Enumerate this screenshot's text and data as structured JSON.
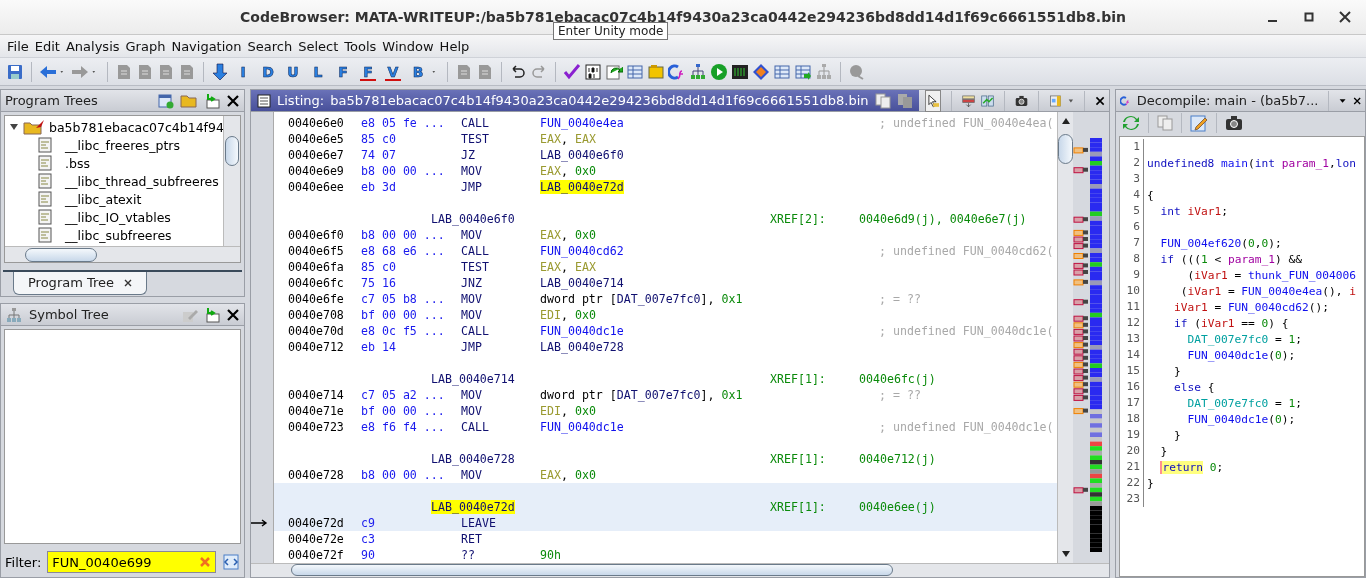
{
  "window": {
    "title": "CodeBrowser: MATA-WRITEUP:/ba5b781ebacac07c4b14f9430a23ca0442e294236bd8dd14d1f69c6661551db8.bin",
    "tooltip": "Enter Unity mode"
  },
  "menu": [
    "File",
    "Edit",
    "Analysis",
    "Graph",
    "Navigation",
    "Search",
    "Select",
    "Tools",
    "Window",
    "Help"
  ],
  "toolbar": {
    "letter_buttons": [
      {
        "glyph": "I",
        "crossed": false
      },
      {
        "glyph": "D",
        "crossed": false
      },
      {
        "glyph": "U",
        "crossed": false
      },
      {
        "glyph": "L",
        "crossed": false
      },
      {
        "glyph": "F",
        "crossed": false
      },
      {
        "glyph": "F",
        "crossed": true
      },
      {
        "glyph": "V",
        "crossed": true
      },
      {
        "glyph": "B",
        "crossed": false
      }
    ]
  },
  "program_trees": {
    "title": "Program Trees",
    "root": {
      "label": "ba5b781ebacac07c4b14f94",
      "expanded": true,
      "children": [
        {
          "label": "__libc_freeres_ptrs"
        },
        {
          "label": ".bss"
        },
        {
          "label": "__libc_thread_subfreeres"
        },
        {
          "label": "__libc_atexit"
        },
        {
          "label": "__libc_IO_vtables"
        },
        {
          "label": "__libc_subfreeres"
        }
      ]
    },
    "tabs": [
      {
        "label": "Program Tree",
        "selected": true
      }
    ]
  },
  "symbol_tree": {
    "title": "Symbol Tree",
    "filter_label": "Filter:",
    "filter": {
      "value": "FUN_0040e699"
    }
  },
  "listing": {
    "title": "Listing:",
    "file": "ba5b781ebacac07c4b14f9430a23ca0442e294236bd8dd14d1f69c6661551db8.bin",
    "rows": [
      {
        "kind": "instr",
        "address": "0040e6e0",
        "bytes": "e8 05 fe ...",
        "mnemonic": "CALL",
        "operands": [
          {
            "text": "FUN_0040e4ea",
            "kind": "fn"
          }
        ],
        "comment": "; undefined FUN_0040e4ea(",
        "selected": false,
        "current": false
      },
      {
        "kind": "instr",
        "address": "0040e6e5",
        "bytes": "85 c0",
        "mnemonic": "TEST",
        "operands": [
          {
            "text": "EAX",
            "kind": "reg"
          },
          {
            "text": ", ",
            "kind": "plain"
          },
          {
            "text": "EAX",
            "kind": "reg"
          }
        ],
        "selected": false,
        "current": false
      },
      {
        "kind": "instr",
        "address": "0040e6e7",
        "bytes": "74 07",
        "mnemonic": "JZ",
        "operands": [
          {
            "text": "LAB_0040e6f0",
            "kind": "lab"
          }
        ],
        "selected": false,
        "current": false
      },
      {
        "kind": "instr",
        "address": "0040e6e9",
        "bytes": "b8 00 00 ...",
        "mnemonic": "MOV",
        "operands": [
          {
            "text": "EAX",
            "kind": "reg"
          },
          {
            "text": ", ",
            "kind": "plain"
          },
          {
            "text": "0x0",
            "kind": "num"
          }
        ],
        "selected": false,
        "current": false
      },
      {
        "kind": "instr",
        "address": "0040e6ee",
        "bytes": "eb 3d",
        "mnemonic": "JMP",
        "operands": [
          {
            "text": "LAB_0040e72d",
            "kind": "lab",
            "highlighted": true
          }
        ],
        "selected": false,
        "current": false
      },
      {
        "kind": "blank",
        "selected": false
      },
      {
        "kind": "label",
        "label": "LAB_0040e6f0",
        "label_highlighted": false,
        "xref_label": "XREF[2]:",
        "xref_targets": "0040e6d9(j), 0040e6e7(j)",
        "selected": false
      },
      {
        "kind": "instr",
        "address": "0040e6f0",
        "bytes": "b8 00 00 ...",
        "mnemonic": "MOV",
        "operands": [
          {
            "text": "EAX",
            "kind": "reg"
          },
          {
            "text": ", ",
            "kind": "plain"
          },
          {
            "text": "0x0",
            "kind": "num"
          }
        ],
        "selected": false,
        "current": false
      },
      {
        "kind": "instr",
        "address": "0040e6f5",
        "bytes": "e8 68 e6 ...",
        "mnemonic": "CALL",
        "operands": [
          {
            "text": "FUN_0040cd62",
            "kind": "fn"
          }
        ],
        "comment": "; undefined FUN_0040cd62(",
        "selected": false,
        "current": false
      },
      {
        "kind": "instr",
        "address": "0040e6fa",
        "bytes": "85 c0",
        "mnemonic": "TEST",
        "operands": [
          {
            "text": "EAX",
            "kind": "reg"
          },
          {
            "text": ", ",
            "kind": "plain"
          },
          {
            "text": "EAX",
            "kind": "reg"
          }
        ],
        "selected": false,
        "current": false
      },
      {
        "kind": "instr",
        "address": "0040e6fc",
        "bytes": "75 16",
        "mnemonic": "JNZ",
        "operands": [
          {
            "text": "LAB_0040e714",
            "kind": "lab"
          }
        ],
        "selected": false,
        "current": false
      },
      {
        "kind": "instr",
        "address": "0040e6fe",
        "bytes": "c7 05 b8 ...",
        "mnemonic": "MOV",
        "operands": [
          {
            "text": "dword ptr [",
            "kind": "plain"
          },
          {
            "text": "DAT_007e7fc0",
            "kind": "lab"
          },
          {
            "text": "], ",
            "kind": "plain"
          },
          {
            "text": "0x1",
            "kind": "num"
          }
        ],
        "comment": "; = ??",
        "selected": false,
        "current": false
      },
      {
        "kind": "instr",
        "address": "0040e708",
        "bytes": "bf 00 00 ...",
        "mnemonic": "MOV",
        "operands": [
          {
            "text": "EDI",
            "kind": "reg"
          },
          {
            "text": ", ",
            "kind": "plain"
          },
          {
            "text": "0x0",
            "kind": "num"
          }
        ],
        "selected": false,
        "current": false
      },
      {
        "kind": "instr",
        "address": "0040e70d",
        "bytes": "e8 0c f5 ...",
        "mnemonic": "CALL",
        "operands": [
          {
            "text": "FUN_0040dc1e",
            "kind": "fn"
          }
        ],
        "comment": "; undefined FUN_0040dc1e(",
        "selected": false,
        "current": false
      },
      {
        "kind": "instr",
        "address": "0040e712",
        "bytes": "eb 14",
        "mnemonic": "JMP",
        "operands": [
          {
            "text": "LAB_0040e728",
            "kind": "lab"
          }
        ],
        "selected": false,
        "current": false
      },
      {
        "kind": "blank",
        "selected": false
      },
      {
        "kind": "label",
        "label": "LAB_0040e714",
        "label_highlighted": false,
        "xref_label": "XREF[1]:",
        "xref_targets": "0040e6fc(j)",
        "selected": false
      },
      {
        "kind": "instr",
        "address": "0040e714",
        "bytes": "c7 05 a2 ...",
        "mnemonic": "MOV",
        "operands": [
          {
            "text": "dword ptr [",
            "kind": "plain"
          },
          {
            "text": "DAT_007e7fc0",
            "kind": "lab"
          },
          {
            "text": "], ",
            "kind": "plain"
          },
          {
            "text": "0x1",
            "kind": "num"
          }
        ],
        "comment": "; = ??",
        "selected": false,
        "current": false
      },
      {
        "kind": "instr",
        "address": "0040e71e",
        "bytes": "bf 00 00 ...",
        "mnemonic": "MOV",
        "operands": [
          {
            "text": "EDI",
            "kind": "reg"
          },
          {
            "text": ", ",
            "kind": "plain"
          },
          {
            "text": "0x0",
            "kind": "num"
          }
        ],
        "selected": false,
        "current": false
      },
      {
        "kind": "instr",
        "address": "0040e723",
        "bytes": "e8 f6 f4 ...",
        "mnemonic": "CALL",
        "operands": [
          {
            "text": "FUN_0040dc1e",
            "kind": "fn"
          }
        ],
        "comment": "; undefined FUN_0040dc1e(",
        "selected": false,
        "current": false
      },
      {
        "kind": "blank",
        "selected": false
      },
      {
        "kind": "label",
        "label": "LAB_0040e728",
        "label_highlighted": false,
        "xref_label": "XREF[1]:",
        "xref_targets": "0040e712(j)",
        "selected": false
      },
      {
        "kind": "instr",
        "address": "0040e728",
        "bytes": "b8 00 00 ...",
        "mnemonic": "MOV",
        "operands": [
          {
            "text": "EAX",
            "kind": "reg"
          },
          {
            "text": ", ",
            "kind": "plain"
          },
          {
            "text": "0x0",
            "kind": "num"
          }
        ],
        "selected": false,
        "current": false
      },
      {
        "kind": "blank",
        "selected": true
      },
      {
        "kind": "label",
        "label": "LAB_0040e72d",
        "label_highlighted": true,
        "xref_label": "XREF[1]:",
        "xref_targets": "0040e6ee(j)",
        "selected": true
      },
      {
        "kind": "instr",
        "address": "0040e72d",
        "bytes": "c9",
        "mnemonic": "LEAVE",
        "operands": [],
        "selected": true,
        "current": true
      },
      {
        "kind": "instr",
        "address": "0040e72e",
        "bytes": "c3",
        "mnemonic": "RET",
        "operands": [],
        "selected": false,
        "current": false
      },
      {
        "kind": "instr",
        "address": "0040e72f",
        "bytes": "90",
        "mnemonic": "??",
        "operands": [
          {
            "text": "90h",
            "kind": "num"
          }
        ],
        "selected": false,
        "current": false
      }
    ]
  },
  "decompile": {
    "title": "Decompile: main -  (ba5b7...",
    "lines": [
      {
        "number": "1"
      },
      {
        "number": "2",
        "tokens": [
          {
            "text": "undefined8 ",
            "kind": "kw"
          },
          {
            "text": "main",
            "kind": "fn"
          },
          {
            "text": "(",
            "kind": "plain"
          },
          {
            "text": "int ",
            "kind": "kw"
          },
          {
            "text": "param_1",
            "kind": "param"
          },
          {
            "text": ",",
            "kind": "plain"
          },
          {
            "text": "lon",
            "kind": "kw"
          }
        ]
      },
      {
        "number": "3"
      },
      {
        "number": "4",
        "tokens": [
          {
            "text": "{",
            "kind": "plain"
          }
        ]
      },
      {
        "number": "5",
        "tokens": [
          {
            "text": "  int ",
            "kind": "kw"
          },
          {
            "text": "iVar1",
            "kind": "var"
          },
          {
            "text": ";",
            "kind": "plain"
          }
        ]
      },
      {
        "number": "6"
      },
      {
        "number": "7",
        "tokens": [
          {
            "text": "  FUN_004ef620",
            "kind": "fn"
          },
          {
            "text": "(",
            "kind": "plain"
          },
          {
            "text": "0",
            "kind": "num"
          },
          {
            "text": ",",
            "kind": "plain"
          },
          {
            "text": "0",
            "kind": "num"
          },
          {
            "text": ");",
            "kind": "plain"
          }
        ]
      },
      {
        "number": "8",
        "tokens": [
          {
            "text": "  if ",
            "kind": "kw"
          },
          {
            "text": "(((",
            "kind": "plain"
          },
          {
            "text": "1",
            "kind": "num"
          },
          {
            "text": " < ",
            "kind": "plain"
          },
          {
            "text": "param_1",
            "kind": "param"
          },
          {
            "text": ") &&",
            "kind": "plain"
          }
        ]
      },
      {
        "number": "9",
        "tokens": [
          {
            "text": "      (",
            "kind": "plain"
          },
          {
            "text": "iVar1",
            "kind": "var"
          },
          {
            "text": " = ",
            "kind": "plain"
          },
          {
            "text": "thunk_FUN_004006",
            "kind": "fn"
          }
        ]
      },
      {
        "number": "10",
        "tokens": [
          {
            "text": "     (",
            "kind": "plain"
          },
          {
            "text": "iVar1",
            "kind": "var"
          },
          {
            "text": " = ",
            "kind": "plain"
          },
          {
            "text": "FUN_0040e4ea",
            "kind": "fn"
          },
          {
            "text": "(), ",
            "kind": "plain"
          },
          {
            "text": "i",
            "kind": "var"
          }
        ]
      },
      {
        "number": "11",
        "tokens": [
          {
            "text": "    iVar1",
            "kind": "var"
          },
          {
            "text": " = ",
            "kind": "plain"
          },
          {
            "text": "FUN_0040cd62",
            "kind": "fn"
          },
          {
            "text": "();",
            "kind": "plain"
          }
        ]
      },
      {
        "number": "12",
        "tokens": [
          {
            "text": "    if ",
            "kind": "kw"
          },
          {
            "text": "(",
            "kind": "plain"
          },
          {
            "text": "iVar1",
            "kind": "var"
          },
          {
            "text": " == ",
            "kind": "plain"
          },
          {
            "text": "0",
            "kind": "num"
          },
          {
            "text": ") {",
            "kind": "plain"
          }
        ]
      },
      {
        "number": "13",
        "tokens": [
          {
            "text": "      DAT_007e7fc0",
            "kind": "global"
          },
          {
            "text": " = ",
            "kind": "plain"
          },
          {
            "text": "1",
            "kind": "num"
          },
          {
            "text": ";",
            "kind": "plain"
          }
        ]
      },
      {
        "number": "14",
        "tokens": [
          {
            "text": "      FUN_0040dc1e",
            "kind": "fn"
          },
          {
            "text": "(",
            "kind": "plain"
          },
          {
            "text": "0",
            "kind": "num"
          },
          {
            "text": ");",
            "kind": "plain"
          }
        ]
      },
      {
        "number": "15",
        "tokens": [
          {
            "text": "    }",
            "kind": "plain"
          }
        ]
      },
      {
        "number": "16",
        "tokens": [
          {
            "text": "    else ",
            "kind": "kw"
          },
          {
            "text": "{",
            "kind": "plain"
          }
        ]
      },
      {
        "number": "17",
        "tokens": [
          {
            "text": "      DAT_007e7fc0",
            "kind": "global"
          },
          {
            "text": " = ",
            "kind": "plain"
          },
          {
            "text": "1",
            "kind": "num"
          },
          {
            "text": ";",
            "kind": "plain"
          }
        ]
      },
      {
        "number": "18",
        "tokens": [
          {
            "text": "      FUN_0040dc1e",
            "kind": "fn"
          },
          {
            "text": "(",
            "kind": "plain"
          },
          {
            "text": "0",
            "kind": "num"
          },
          {
            "text": ");",
            "kind": "plain"
          }
        ]
      },
      {
        "number": "19",
        "tokens": [
          {
            "text": "    }",
            "kind": "plain"
          }
        ]
      },
      {
        "number": "20",
        "tokens": [
          {
            "text": "  }",
            "kind": "plain"
          }
        ]
      },
      {
        "number": "21",
        "tokens": [
          {
            "text": "  return",
            "kind": "kw",
            "highlighted": true
          },
          {
            "text": " 0",
            "kind": "num"
          },
          {
            "text": ";",
            "kind": "plain"
          }
        ]
      },
      {
        "number": "22",
        "tokens": [
          {
            "text": "}",
            "kind": "plain"
          }
        ]
      },
      {
        "number": "23"
      }
    ]
  }
}
